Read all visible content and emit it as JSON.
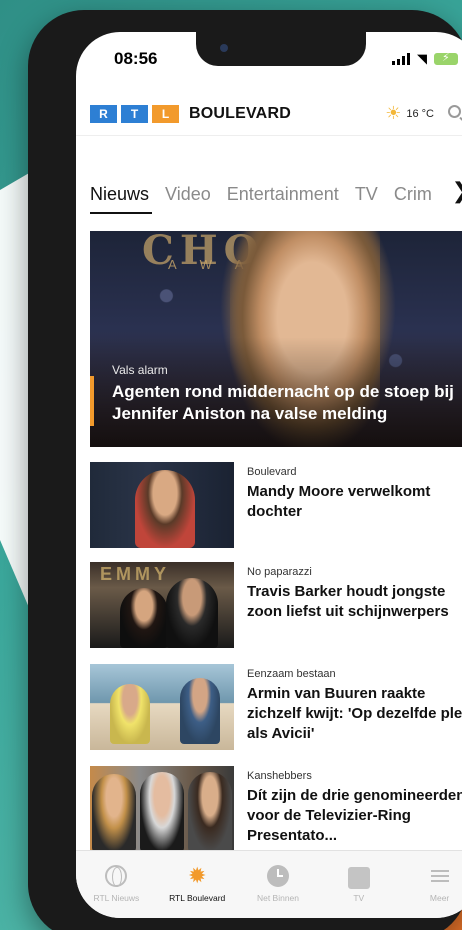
{
  "status": {
    "time": "08:56"
  },
  "header": {
    "logo_letters": [
      "R",
      "T",
      "L"
    ],
    "brand": "BOULEVARD",
    "weather_temp": "16 °C"
  },
  "tabs": [
    "Nieuws",
    "Video",
    "Entertainment",
    "TV",
    "Crim"
  ],
  "hero": {
    "kicker": "Vals alarm",
    "title": "Agenten rond middernacht op de stoep bij Jennifer Aniston na valse melding",
    "bg_text_1": "CHOIC",
    "bg_text_2": "A W A R"
  },
  "articles": [
    {
      "kicker": "Boulevard",
      "title": "Mandy Moore verwelkomt dochter"
    },
    {
      "kicker": "No paparazzi",
      "title": "Travis Barker houdt jongste zoon liefst uit schijnwerpers",
      "bg_text": "EMMY"
    },
    {
      "kicker": "Eenzaam bestaan",
      "title": "Armin van Buuren raakte zichzelf kwijt: 'Op dezelfde plek als Avicii'"
    },
    {
      "kicker": "Kanshebbers",
      "title": "Dít zijn de drie genomineerden voor de Televizier-Ring Presentato..."
    }
  ],
  "tabbar": [
    {
      "label": "RTL Nieuws",
      "icon": "globe-icon"
    },
    {
      "label": "RTL Boulevard",
      "icon": "star-burst-icon"
    },
    {
      "label": "Net Binnen",
      "icon": "clock-icon"
    },
    {
      "label": "TV",
      "icon": "tv-icon"
    },
    {
      "label": "Meer",
      "icon": "menu-icon"
    }
  ],
  "colors": {
    "accent": "#f29a2c",
    "brand_blue": "#2d7fd4",
    "background": "#3aa79b"
  }
}
